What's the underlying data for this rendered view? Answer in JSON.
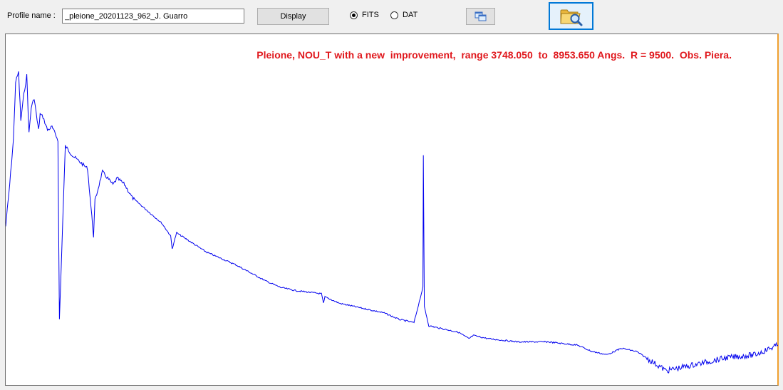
{
  "toolbar": {
    "profile_label": "Profile name :",
    "profile_value": "_pleione_20201123_962_J. Guarro",
    "display_label": "Display",
    "format_options": [
      {
        "label": "FITS",
        "selected": true
      },
      {
        "label": "DAT",
        "selected": false
      }
    ],
    "copy_icon": "copy-windows-icon",
    "open_icon": "folder-search-icon"
  },
  "plot": {
    "title": "Pleione, NOU_T with a new  improvement,  range 3748.050  to  8953.650 Angs.  R = 9500.  Obs. Piera.",
    "title_color": "#e0181d",
    "line_color": "#0000ee"
  },
  "chart_data": {
    "type": "line",
    "title": "Pleione, NOU_T with a new  improvement,  range 3748.050  to  8953.650 Angs.  R = 9500.  Obs. Piera.",
    "x_range": [
      3748.05,
      8953.65
    ],
    "y_range": [
      0,
      1.0
    ],
    "series": [
      {
        "x": [
          3748,
          3775,
          3800,
          3815,
          3835,
          3850,
          3870,
          3890,
          3905,
          3920,
          3940,
          3960,
          3970,
          3980,
          4000,
          4030,
          4060,
          4100,
          4110,
          4150,
          4200,
          4300,
          4340,
          4350,
          4400,
          4471,
          4500,
          4550,
          4600,
          4700,
          4800,
          4860,
          4870,
          4900,
          5000,
          5100,
          5300,
          5500,
          5600,
          5700,
          5876,
          5890,
          5900,
          6000,
          6200,
          6300,
          6400,
          6500,
          6560,
          6563,
          6570,
          6600,
          6700,
          6800,
          6870,
          6900,
          7000,
          7200,
          7400,
          7600,
          7700,
          7800,
          7900,
          8000,
          8100,
          8200,
          8400,
          8600,
          8800,
          8953
        ],
        "y": [
          0.45,
          0.58,
          0.72,
          0.9,
          0.93,
          0.78,
          0.86,
          0.92,
          0.74,
          0.82,
          0.85,
          0.78,
          0.75,
          0.8,
          0.79,
          0.75,
          0.76,
          0.72,
          0.16,
          0.7,
          0.67,
          0.63,
          0.42,
          0.53,
          0.62,
          0.58,
          0.6,
          0.58,
          0.54,
          0.5,
          0.46,
          0.42,
          0.38,
          0.43,
          0.4,
          0.37,
          0.33,
          0.28,
          0.26,
          0.25,
          0.24,
          0.21,
          0.23,
          0.21,
          0.19,
          0.18,
          0.16,
          0.15,
          0.26,
          0.67,
          0.2,
          0.14,
          0.13,
          0.12,
          0.1,
          0.11,
          0.1,
          0.09,
          0.09,
          0.08,
          0.06,
          0.05,
          0.07,
          0.06,
          0.03,
          0.0,
          0.02,
          0.04,
          0.05,
          0.08
        ]
      }
    ]
  }
}
